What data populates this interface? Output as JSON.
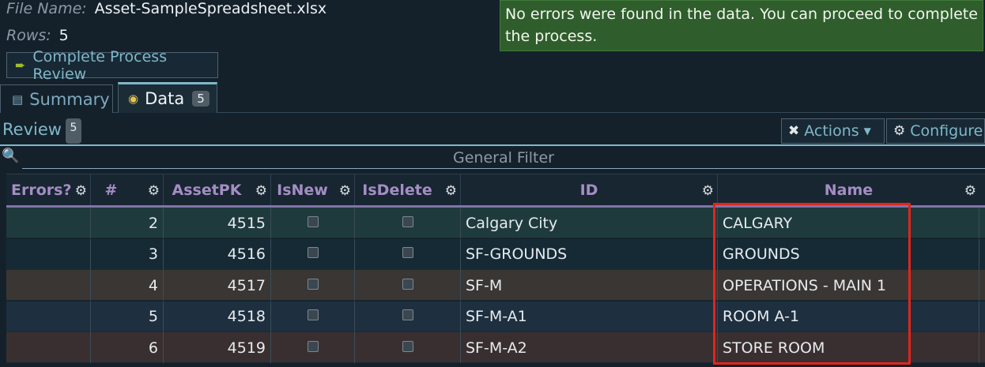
{
  "file": {
    "label": "File Name:",
    "value": "Asset-SampleSpreadsheet.xlsx"
  },
  "rows": {
    "label": "Rows:",
    "value": "5"
  },
  "complete_button": {
    "label": "Complete Process Review",
    "icon": "arrow-right-icon"
  },
  "message": {
    "text": "No errors were found in the data. You can proceed to complete the process.",
    "color": "#2f5e2c"
  },
  "tabs": [
    {
      "label": "Summary",
      "icon": "document-icon",
      "active": false
    },
    {
      "label": "Data",
      "icon": "database-icon",
      "badge": "5",
      "active": true
    }
  ],
  "review": {
    "title": "Review",
    "badge": "5",
    "actions_label": "Actions",
    "configure_label": "Configure"
  },
  "filter": {
    "placeholder": "General Filter",
    "icon": "search-icon"
  },
  "table": {
    "columns": [
      "Errors?",
      "#",
      "AssetPK",
      "IsNew",
      "IsDelete",
      "ID",
      "Name"
    ],
    "rows": [
      {
        "errors": "",
        "num": "2",
        "assetpk": "4515",
        "isnew": false,
        "isdelete": false,
        "id": "Calgary City",
        "name": "CALGARY"
      },
      {
        "errors": "",
        "num": "3",
        "assetpk": "4516",
        "isnew": false,
        "isdelete": false,
        "id": "SF-GROUNDS",
        "name": "GROUNDS"
      },
      {
        "errors": "",
        "num": "4",
        "assetpk": "4517",
        "isnew": false,
        "isdelete": false,
        "id": "SF-M",
        "name": "OPERATIONS - MAIN 1"
      },
      {
        "errors": "",
        "num": "5",
        "assetpk": "4518",
        "isnew": false,
        "isdelete": false,
        "id": "SF-M-A1",
        "name": "ROOM A-1"
      },
      {
        "errors": "",
        "num": "6",
        "assetpk": "4519",
        "isnew": false,
        "isdelete": false,
        "id": "SF-M-A2",
        "name": "STORE ROOM"
      }
    ],
    "row_colors": [
      "#1e3a3d",
      "#152a35",
      "#3a3633",
      "#1e2f3f",
      "#3a2f30"
    ]
  },
  "highlight_color": "#e1251b"
}
